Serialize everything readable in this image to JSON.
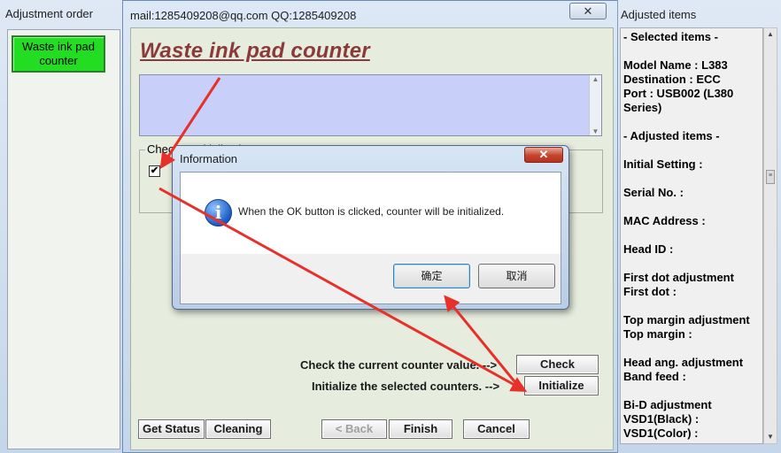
{
  "left_window": {
    "title": "Adjustment order",
    "selected_item": "Waste ink pad counter"
  },
  "main_window": {
    "title": "mail:1285409208@qq.com QQ:1285409208",
    "heading": "Waste ink pad counter",
    "group_label": "Check & Initialization",
    "check_label": "Check the current counter value. -->",
    "check_button": "Check",
    "initialize_label": "Initialize the selected counters. -->",
    "initialize_button": "Initialize",
    "footer": {
      "get_status": "Get Status",
      "cleaning": "Cleaning",
      "back": "< Back",
      "finish": "Finish",
      "cancel": "Cancel"
    }
  },
  "right_window": {
    "title": "Adjusted items",
    "lines": [
      "- Selected items -",
      "",
      "Model Name : L383",
      "Destination : ECC",
      "Port : USB002 (L380",
      "Series)",
      "",
      "- Adjusted items -",
      "",
      "Initial Setting :",
      "",
      "Serial No. :",
      "",
      "MAC Address :",
      "",
      "Head ID :",
      "",
      "First dot adjustment",
      " First dot :",
      "",
      "Top margin adjustment",
      " Top margin :",
      "",
      "Head ang. adjustment",
      " Band feed :",
      "",
      "Bi-D adjustment",
      " VSD1(Black) :",
      " VSD1(Color) :"
    ]
  },
  "dialog": {
    "title": "Information",
    "message": "When the OK button is clicked, counter will be initialized.",
    "ok_button": "确定",
    "cancel_button": "取消",
    "icon": "info-icon"
  },
  "annotation": {
    "color": "#e8302a"
  }
}
